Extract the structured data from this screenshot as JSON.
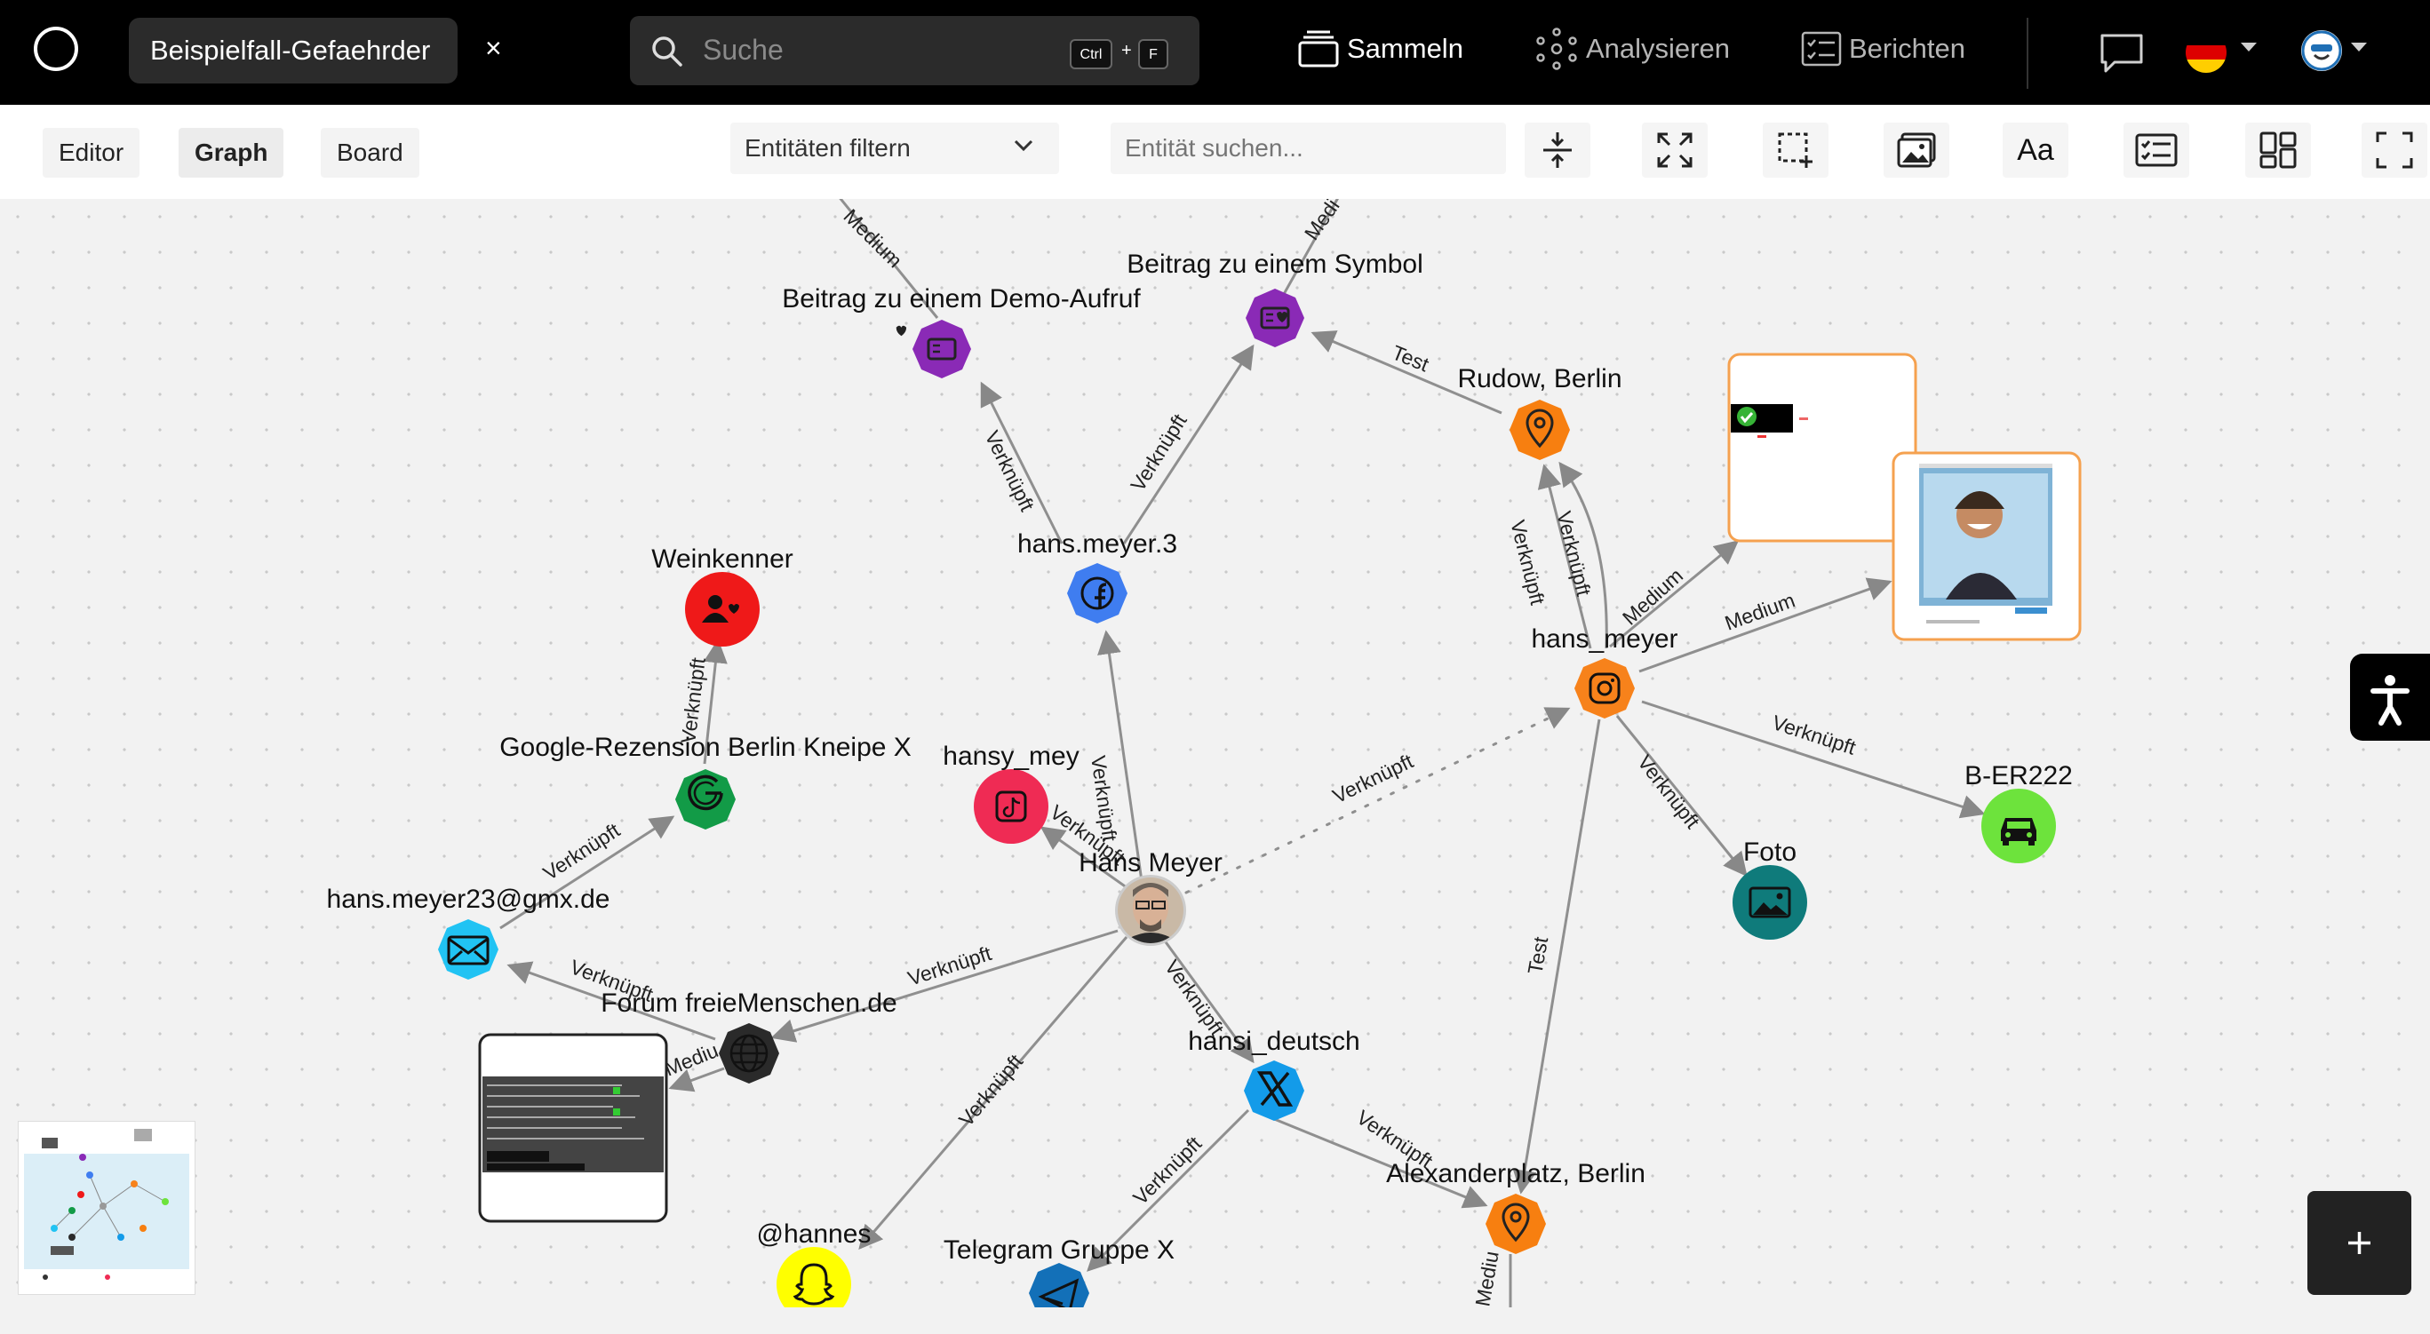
{
  "header": {
    "case_tab": "Beispielfall-Gefaehrder",
    "close_symbol": "×",
    "search_placeholder": "Suche",
    "shortcut_ctrl": "Ctrl",
    "shortcut_plus": "+",
    "shortcut_key": "F",
    "nav": {
      "collect": "Sammeln",
      "analyze": "Analysieren",
      "report": "Berichten"
    }
  },
  "toolbar": {
    "tabs": {
      "editor": "Editor",
      "graph": "Graph",
      "board": "Board"
    },
    "active_tab": "Graph",
    "filter_label": "Entitäten filtern",
    "entity_search_placeholder": "Entität suchen...",
    "font_button": "Aa"
  },
  "graph": {
    "nodes": {
      "hans_meyer": "Hans Meyer",
      "demo_post": "Beitrag zu einem Demo-Aufruf",
      "symbol_post": "Beitrag zu einem Symbol",
      "rudow": "Rudow, Berlin",
      "fb_account": "hans.meyer.3",
      "ig_account": "hans_meyer",
      "weinkenner": "Weinkenner",
      "google_review": "Google-Rezension Berlin Kneipe X",
      "tiktok": "hansy_mey",
      "email": "hans.meyer23@gmx.de",
      "forum": "Forum freieMenschen.de",
      "twitter": "hansi_deutsch",
      "plate": "B-ER222",
      "photo": "Foto",
      "alexanderplatz": "Alexanderplatz, Berlin",
      "snapchat": "@hannes",
      "telegram": "Telegram Gruppe X"
    },
    "edge_labels": {
      "linked": "Verknüpft",
      "medium": "Medium",
      "medium_partial": "Mediu",
      "medium_cut": "Medi",
      "test": "Test"
    }
  },
  "colors": {
    "post": "#8a2ab6",
    "location": "#f77f10",
    "facebook": "#3f7df0",
    "instagram": "#f7821b",
    "interest": "#ef1919",
    "google": "#129b47",
    "tiktok": "#ef2b54",
    "email": "#21c3f3",
    "web": "#2a2a2a",
    "twitter": "#139be9",
    "vehicle": "#6de33c",
    "image": "#0f7b7b",
    "snapchat": "#ffff00",
    "telegram": "#1370b8",
    "edge": "#888888"
  }
}
